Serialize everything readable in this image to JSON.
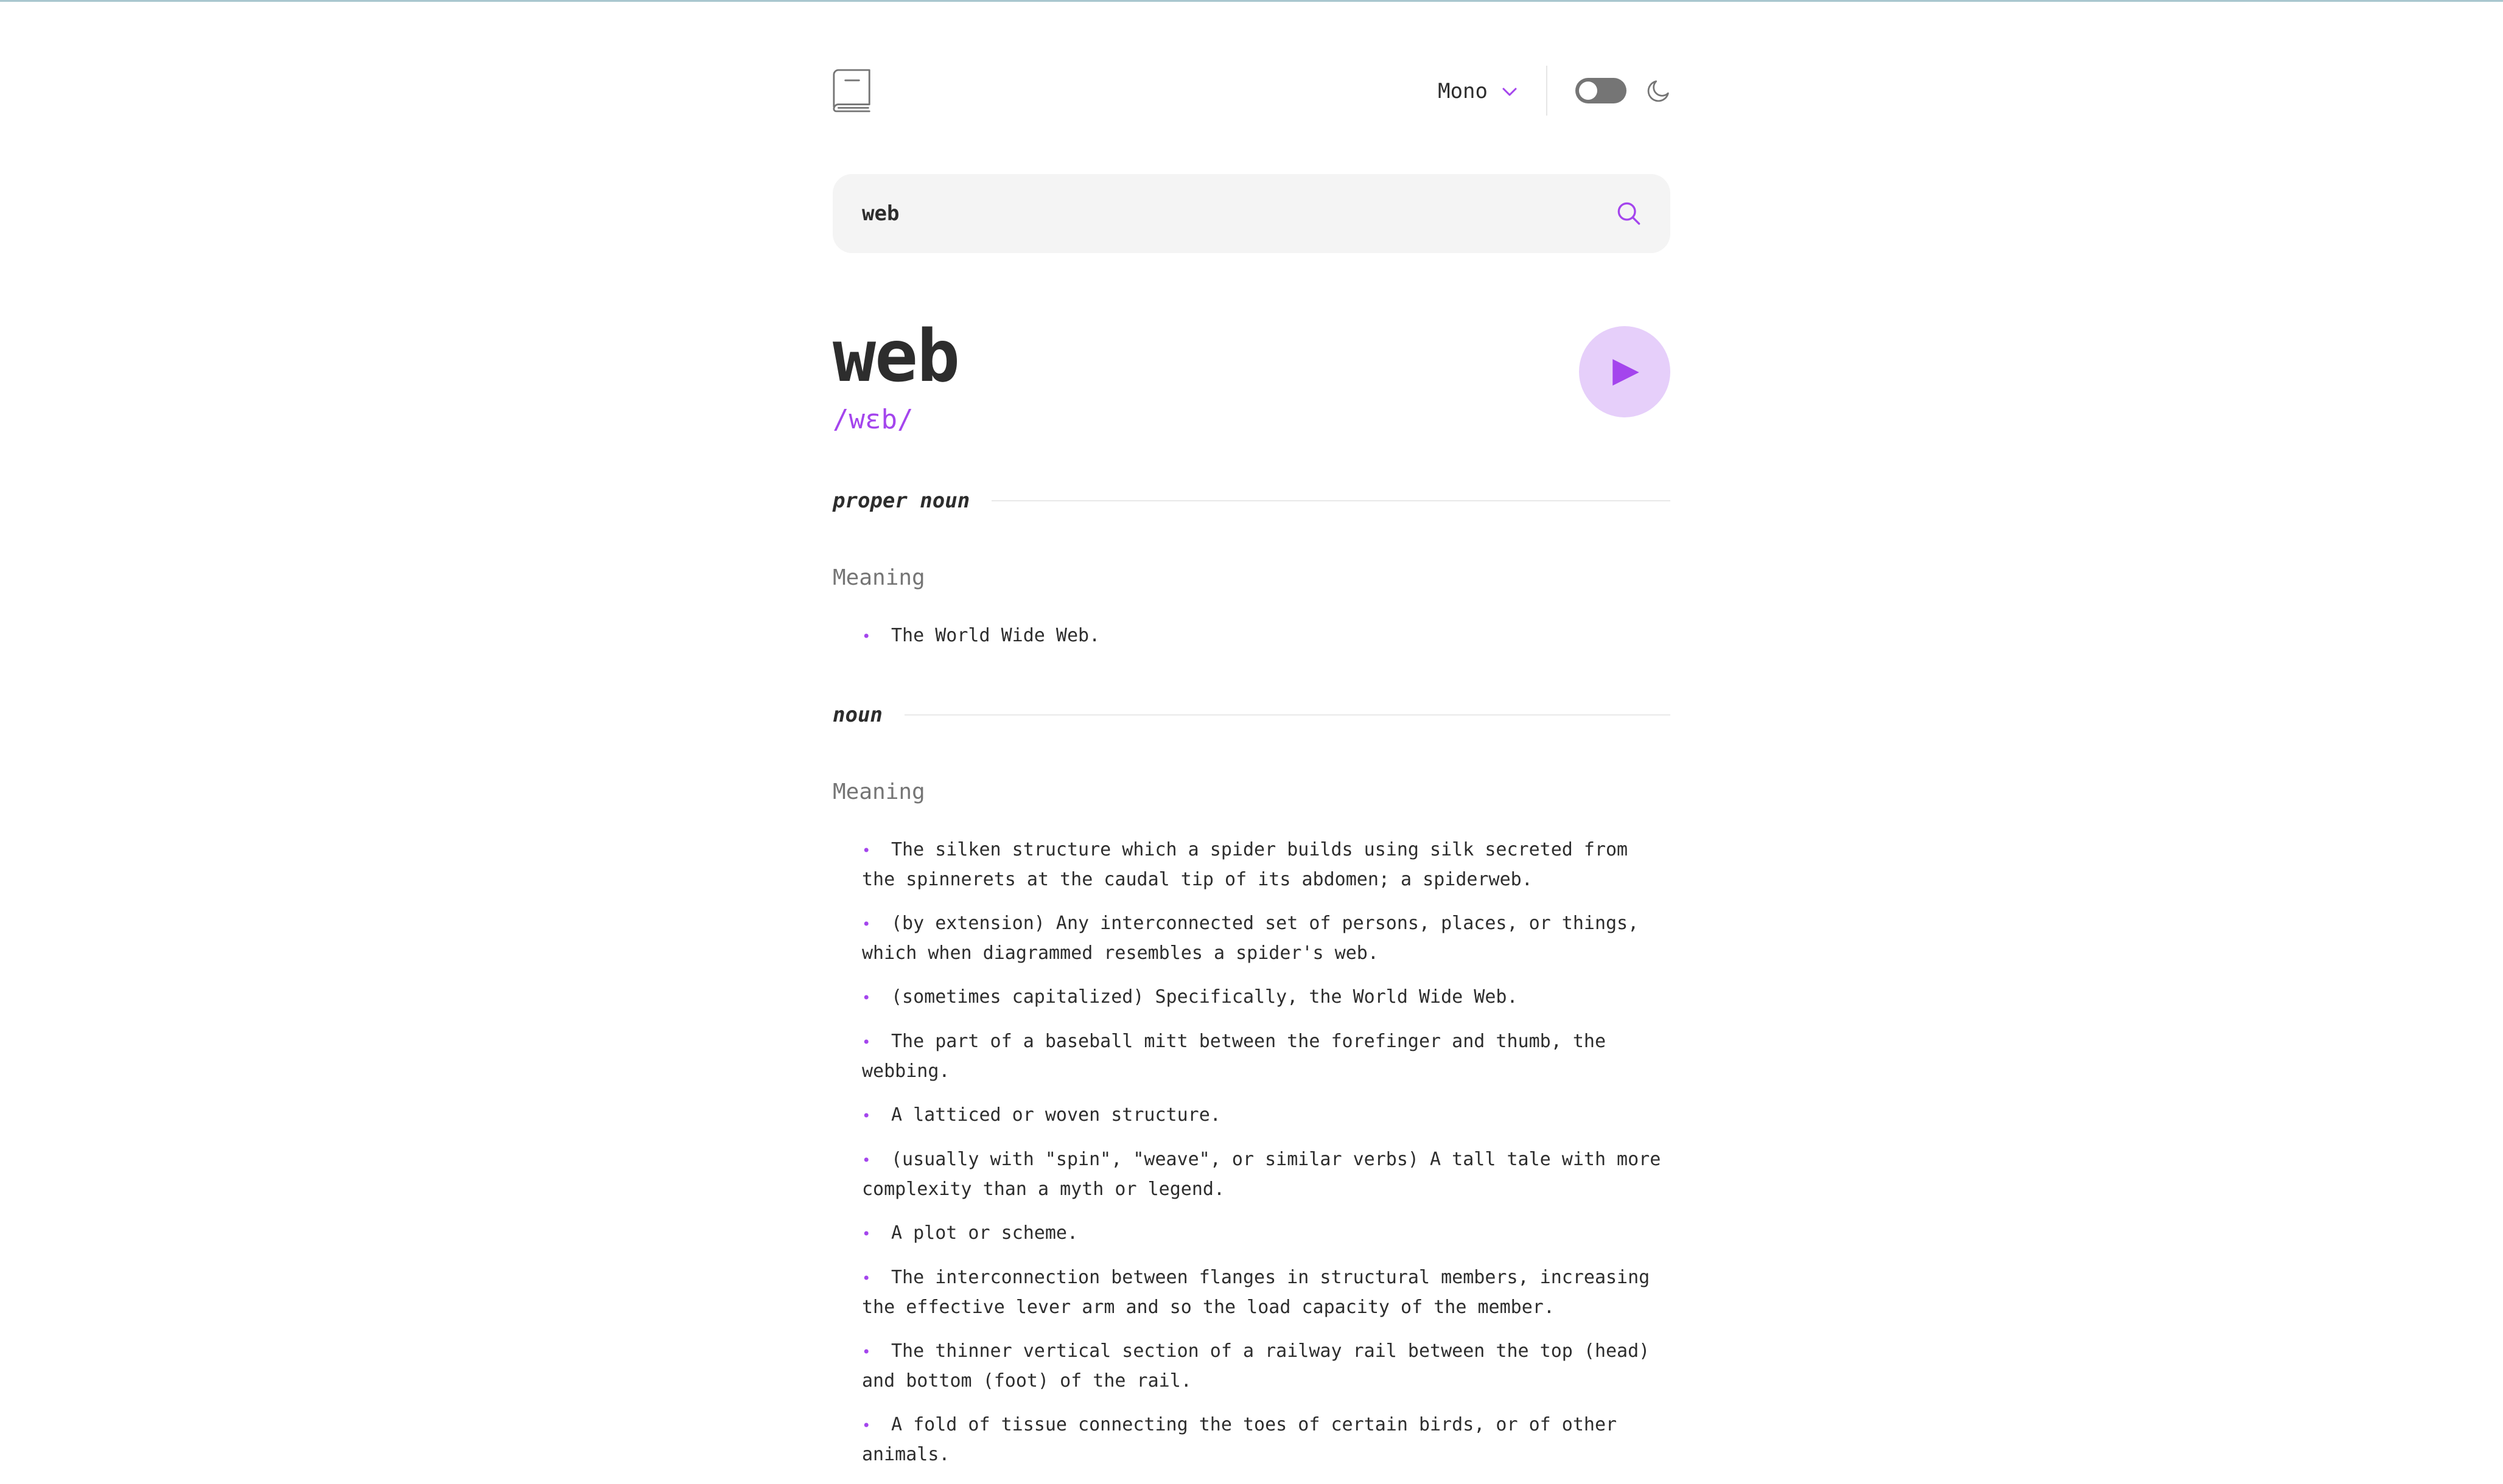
{
  "header": {
    "font_label": "Mono",
    "logo_icon": "book-icon",
    "theme_toggle": "off",
    "theme_icon": "moon-icon"
  },
  "search": {
    "value": "web",
    "icon": "search-icon"
  },
  "entry": {
    "word": "web",
    "phonetic": "/wɛb/",
    "play_icon": "play-icon"
  },
  "meanings": [
    {
      "part_of_speech": "proper noun",
      "meaning_label": "Meaning",
      "definitions": [
        "The World Wide Web."
      ]
    },
    {
      "part_of_speech": "noun",
      "meaning_label": "Meaning",
      "definitions": [
        "The silken structure which a spider builds using silk secreted from the spinnerets at the caudal tip of its abdomen; a spiderweb.",
        "(by extension) Any interconnected set of persons, places, or things, which when diagrammed resembles a spider's web.",
        "(sometimes capitalized) Specifically, the World Wide Web.",
        "The part of a baseball mitt between the forefinger and thumb, the webbing.",
        "A latticed or woven structure.",
        "(usually with \"spin\", \"weave\", or similar verbs) A tall tale with more complexity than a myth or legend.",
        "A plot or scheme.",
        "The interconnection between flanges in structural members, increasing the effective lever arm and so the load capacity of the member.",
        "The thinner vertical section of a railway rail between the top (head) and bottom (foot) of the rail.",
        "A fold of tissue connecting the toes of certain birds, or of other animals."
      ]
    }
  ],
  "colors": {
    "accent": "#a445ed",
    "accent_light": "#e6cffa",
    "text": "#2d2d2d",
    "muted": "#757575",
    "search_bg": "#f4f4f4"
  }
}
